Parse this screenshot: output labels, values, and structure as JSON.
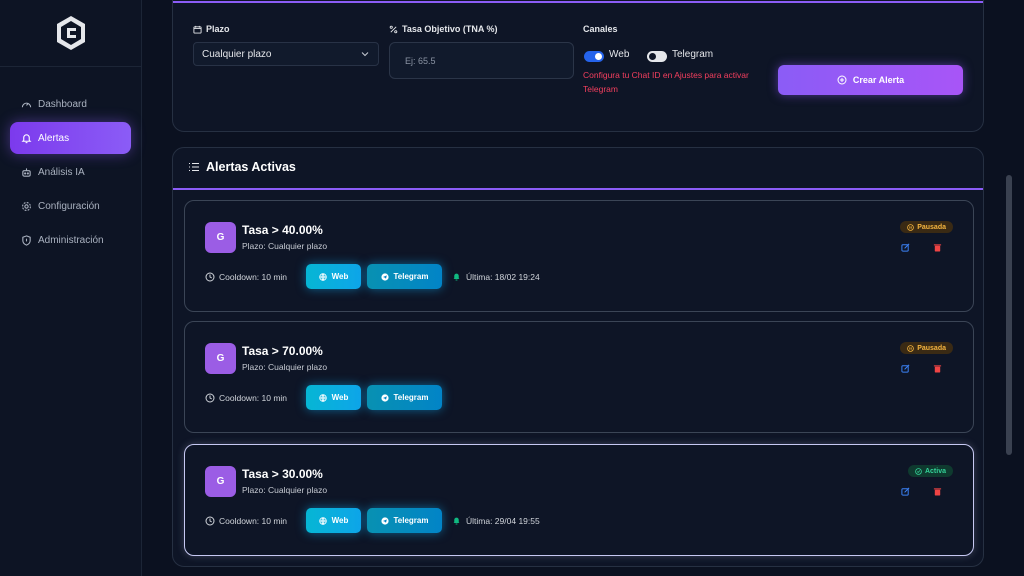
{
  "sidebar": {
    "items": [
      {
        "label": "Dashboard",
        "icon": "gauge-icon"
      },
      {
        "label": "Alertas",
        "icon": "bell-icon",
        "active": true
      },
      {
        "label": "Análisis IA",
        "icon": "robot-icon"
      },
      {
        "label": "Configuración",
        "icon": "gear-icon"
      },
      {
        "label": "Administración",
        "icon": "shield-icon"
      }
    ]
  },
  "form": {
    "plazo_label": "Plazo",
    "plazo_value": "Cualquier plazo",
    "tasa_label": "Tasa Objetivo (TNA %)",
    "tasa_placeholder": "Ej: 65.5",
    "canales_label": "Canales",
    "web_label": "Web",
    "telegram_label": "Telegram",
    "warning": "Configura tu Chat ID en Ajustes para activar Telegram",
    "create_label": "Crear Alerta"
  },
  "list": {
    "title": "Alertas Activas",
    "cards": [
      {
        "avatar": "G",
        "title": "Tasa > 40.00%",
        "subtitle": "Plazo: Cualquier plazo",
        "cooldown": "Cooldown: 10 min",
        "web": "Web",
        "telegram": "Telegram",
        "last": "Última: 18/02 19:24",
        "status": "Pausada"
      },
      {
        "avatar": "G",
        "title": "Tasa > 70.00%",
        "subtitle": "Plazo: Cualquier plazo",
        "cooldown": "Cooldown: 10 min",
        "web": "Web",
        "telegram": "Telegram",
        "last": "",
        "status": "Pausada"
      },
      {
        "avatar": "G",
        "title": "Tasa > 30.00%",
        "subtitle": "Plazo: Cualquier plazo",
        "cooldown": "Cooldown: 10 min",
        "web": "Web",
        "telegram": "Telegram",
        "last": "Última: 29/04 19:55",
        "status": "Activa"
      }
    ]
  },
  "colors": {
    "accent": "#8b5cf6",
    "chip": "#0ea5e9",
    "warning": "#f43f5e",
    "paused": "#f5b53f",
    "active": "#34d399"
  }
}
